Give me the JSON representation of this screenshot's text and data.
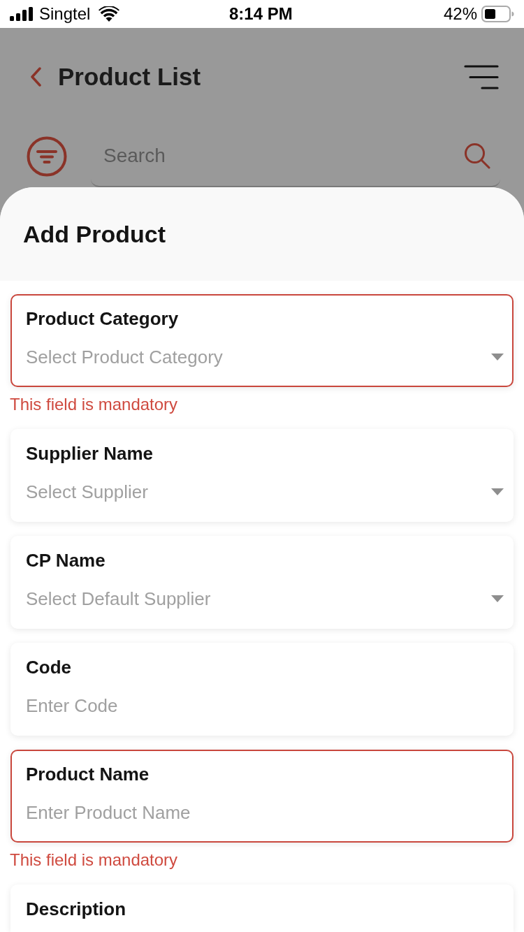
{
  "status_bar": {
    "carrier": "Singtel",
    "time": "8:14 PM",
    "battery": "42%"
  },
  "header": {
    "title": "Product List"
  },
  "search": {
    "placeholder": "Search"
  },
  "sheet": {
    "title": "Add Product",
    "fields": [
      {
        "label": "Product Category",
        "kind": "dropdown",
        "placeholder": "Select Product Category",
        "invalid": true,
        "error": "This field is mandatory"
      },
      {
        "label": "Supplier Name",
        "kind": "dropdown",
        "placeholder": "Select Supplier",
        "invalid": false
      },
      {
        "label": "CP Name",
        "kind": "dropdown",
        "placeholder": "Select Default Supplier",
        "invalid": false
      },
      {
        "label": "Code",
        "kind": "text",
        "placeholder": "Enter Code",
        "invalid": false
      },
      {
        "label": "Product Name",
        "kind": "text",
        "placeholder": "Enter Product Name",
        "invalid": true,
        "error": "This field is mandatory"
      },
      {
        "label": "Description",
        "invalid": false
      }
    ]
  }
}
